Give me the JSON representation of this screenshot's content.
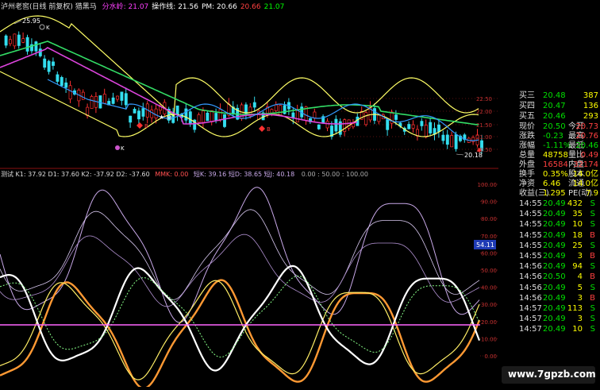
{
  "top_legend": {
    "title": "泸州老窖(日线 前复权) 猎黑马",
    "items": [
      {
        "label": "分水岭: 21.07",
        "color": "#ff40ff"
      },
      {
        "label": "操作线: 21.56",
        "color": "#ffffff"
      },
      {
        "label": "PM: 20.66",
        "color": "#ffffff"
      },
      {
        "label": "20.66",
        "color": "#ff4040"
      },
      {
        "label": "21.07",
        "color": "#00ff00"
      }
    ]
  },
  "price_labels": {
    "high": "25.95",
    "low": "20.18",
    "k1": "K",
    "k2": "K",
    "buy1": "B",
    "buy2": "M",
    "buy3": "B",
    "buy4": "B"
  },
  "price_axis": [
    "22.50",
    "22.00",
    "21.50",
    "21.00",
    "20.50"
  ],
  "lower_legend": {
    "title": "测试 K1: 37.92 D1: 37.60 K2: -37.92 D2: -37.60",
    "mmk": "MMK: 0.00",
    "rest": "短K: 39.16 短D: 38.65 短J: 40.18",
    "tail": "0.00 : 50.00 : 100.00"
  },
  "lower_axis": [
    "100.00",
    "90.00",
    "80.00",
    "70.00",
    "60.00",
    "50.00",
    "40.00",
    "30.00",
    "20.00",
    "10.00",
    "0.00"
  ],
  "current_marker": "54.11",
  "quote": {
    "levels": [
      {
        "label": "买三",
        "price": "20.48",
        "vol": "387"
      },
      {
        "label": "买四",
        "price": "20.47",
        "vol": "136"
      },
      {
        "label": "买五",
        "price": "20.46",
        "vol": "293"
      }
    ],
    "fields": [
      {
        "l1": "现价",
        "v1": "20.50",
        "l2": "今开",
        "v2": "20.73"
      },
      {
        "l1": "涨跌",
        "v1": "-0.23",
        "l2": "最高",
        "v2": "20.76"
      },
      {
        "l1": "涨幅",
        "v1": "-1.11%",
        "l2": "最低",
        "v2": "20.46"
      },
      {
        "l1": "总量",
        "v1": "48758",
        "l2": "量比",
        "v2": "0.49"
      },
      {
        "l1": "外盘",
        "v1": "16584",
        "l2": "内盘",
        "v2": "32174"
      }
    ],
    "fields2": [
      {
        "l1": "换手",
        "v1": "0.35%",
        "l2": "股本",
        "v2": "14.0亿"
      },
      {
        "l1": "净资",
        "v1": "6.46",
        "l2": "流通",
        "v2": "14.0亿"
      },
      {
        "l1": "收益(三)",
        "v1": "1.295",
        "l2": "PE(动)",
        "v2": "7.9"
      }
    ]
  },
  "ticks": [
    {
      "time": "14:55",
      "price": "20.49",
      "vol": "432",
      "side": "S"
    },
    {
      "time": "14:55",
      "price": "20.49",
      "vol": "35",
      "side": "S"
    },
    {
      "time": "14:55",
      "price": "20.49",
      "vol": "10",
      "side": "S"
    },
    {
      "time": "14:55",
      "price": "20.49",
      "vol": "18",
      "side": "B"
    },
    {
      "time": "14:55",
      "price": "20.49",
      "vol": "25",
      "side": "S"
    },
    {
      "time": "14:55",
      "price": "20.49",
      "vol": "3",
      "side": "B"
    },
    {
      "time": "14:56",
      "price": "20.49",
      "vol": "94",
      "side": "S"
    },
    {
      "time": "14:56",
      "price": "20.50",
      "vol": "4",
      "side": "B"
    },
    {
      "time": "14:56",
      "price": "20.49",
      "vol": "5",
      "side": "S"
    },
    {
      "time": "14:56",
      "price": "20.49",
      "vol": "3",
      "side": "B"
    },
    {
      "time": "14:57",
      "price": "20.49",
      "vol": "113",
      "side": "S"
    },
    {
      "time": "14:57",
      "price": "20.49",
      "vol": "3",
      "side": "S"
    },
    {
      "time": "14:57",
      "price": "20.49",
      "vol": "10",
      "side": "S"
    }
  ],
  "watermark": "www.7gpzb.com"
}
